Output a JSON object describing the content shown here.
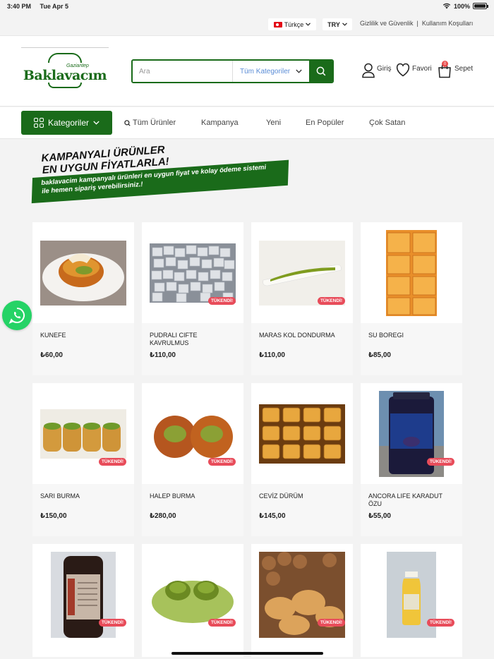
{
  "status": {
    "time": "3:40 PM",
    "date": "Tue Apr 5",
    "battery": "100%",
    "battery_level": 1.0
  },
  "topbar": {
    "language": "Türkçe",
    "currency": "TRY",
    "links": [
      "Gizlilik ve Güvenlik",
      "|",
      "Kullanım Koşulları"
    ]
  },
  "logo": {
    "subtitle": "Gaziantep",
    "text": "Baklavacım"
  },
  "search": {
    "placeholder": "Ara",
    "category": "Tüm Kategoriler"
  },
  "header_actions": {
    "login": "Giriş",
    "favorites": "Favori",
    "cart": "Sepet",
    "cart_count": "0"
  },
  "nav": {
    "categories_button": "Kategoriler",
    "items": [
      "Tüm Ürünler",
      "Kampanya",
      "Yeni",
      "En Popüler",
      "Çok Satan"
    ]
  },
  "banner": {
    "title_line1": "KAMPANYALI ÜRÜNLER",
    "title_line2": "EN UYGUN FİYATLARLA!",
    "text_line1": "baklavacim kampanyalı ürünleri en uygun fiyat ve kolay ödeme sistemi",
    "text_line2": "ile hemen sipariş verebilirsiniz.!"
  },
  "products": [
    {
      "name": "KUNEFE",
      "price": "₺60,00",
      "sold_out": false
    },
    {
      "name": "PUDRALI CIFTE KAVRULMUS",
      "price": "₺110,00",
      "sold_out": true
    },
    {
      "name": "MARAS KOL DONDURMA",
      "price": "₺110,00",
      "sold_out": true
    },
    {
      "name": "SU BOREGI",
      "price": "₺85,00",
      "sold_out": false
    },
    {
      "name": "SARI BURMA",
      "price": "₺150,00",
      "sold_out": true
    },
    {
      "name": "HALEP BURMA",
      "price": "₺280,00",
      "sold_out": true
    },
    {
      "name": "CEVİZ DÜRÜM",
      "price": "₺145,00",
      "sold_out": false
    },
    {
      "name": "ANCORA LIFE KARADUT ÖZU",
      "price": "₺55,00",
      "sold_out": true
    },
    {
      "name": "",
      "price": "",
      "sold_out": true
    },
    {
      "name": "",
      "price": "",
      "sold_out": true
    },
    {
      "name": "",
      "price": "",
      "sold_out": true
    },
    {
      "name": "",
      "price": "",
      "sold_out": true
    }
  ],
  "sold_out_label": "TÜKENDİ!",
  "colors": {
    "brand_green": "#1a6b1a",
    "badge_red": "#e84c5a",
    "whatsapp": "#25d366"
  },
  "icons": [
    "search-icon",
    "user-icon",
    "heart-icon",
    "bag-icon",
    "grid-icon",
    "whatsapp-icon"
  ]
}
